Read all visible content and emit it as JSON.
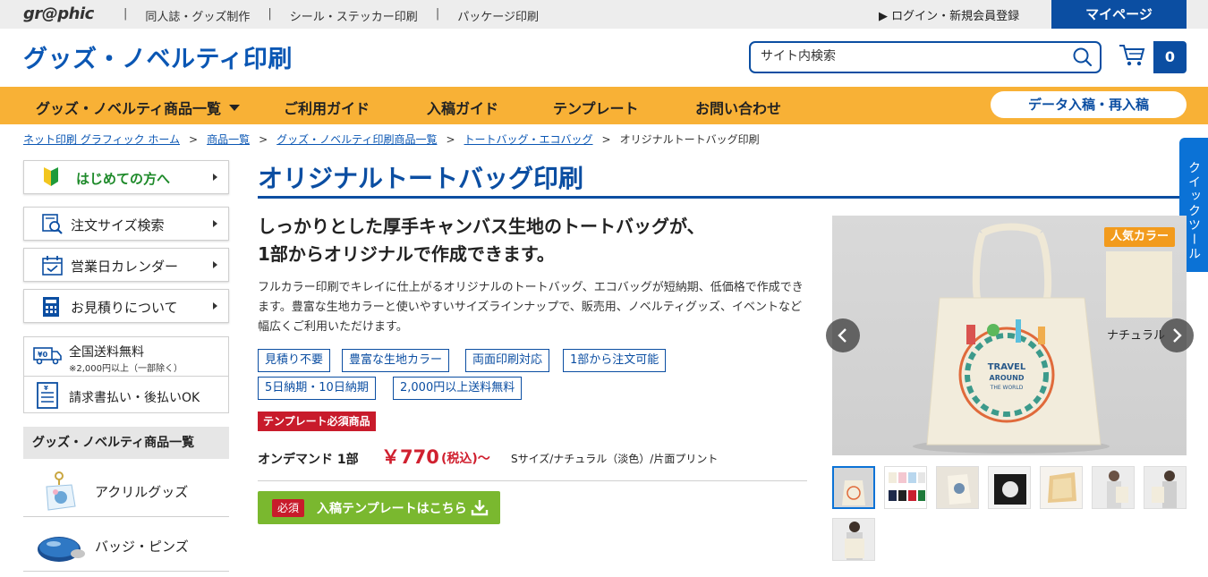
{
  "topbar": {
    "logo": "gr@phic",
    "links": [
      "同人誌・グッズ制作",
      "シール・ステッカー印刷",
      "パッケージ印刷"
    ],
    "login": "▶ ログイン・新規会員登録",
    "mypage": "マイページ"
  },
  "header": {
    "title": "グッズ・ノベルティ印刷",
    "search_placeholder": "サイト内検索",
    "cart_count": "0"
  },
  "gnav": {
    "items": [
      "グッズ・ノベルティ商品一覧",
      "ご利用ガイド",
      "入稿ガイド",
      "テンプレート",
      "お問い合わせ"
    ],
    "upload_button": "データ入稿・再入稿"
  },
  "breadcrumb": {
    "links": [
      "ネット印刷 グラフィック ホーム",
      "商品一覧",
      "グッズ・ノベルティ印刷商品一覧",
      "トートバッグ・エコバッグ"
    ],
    "separator": ">",
    "current": "オリジナルトートバッグ印刷"
  },
  "quick_tool": "クイックツール",
  "sidebar": {
    "buttons": [
      "はじめての方へ",
      "注文サイズ検索",
      "営業日カレンダー",
      "お見積りについて"
    ],
    "info": {
      "shipping_title": "全国送料無料",
      "shipping_note": "※2,000円以上（一部除く）",
      "invoice": "請求書払い・後払いOK"
    },
    "category_heading": "グッズ・ノベルティ商品一覧",
    "categories": [
      "アクリルグッズ",
      "バッジ・ピンズ"
    ]
  },
  "main": {
    "title": "オリジナルトートバッグ印刷",
    "lead_line1": "しっかりとした厚手キャンバス生地のトートバッグが、",
    "lead_line2": "1部からオリジナルで作成できます。",
    "description": "フルカラー印刷でキレイに仕上がるオリジナルのトートバッグ、エコバッグが短納期、低価格で作成できます。豊富な生地カラーと使いやすいサイズラインナップで、販売用、ノベルティグッズ、イベントなど幅広くご利用いただけます。",
    "tags": [
      "見積り不要",
      "豊富な生地カラー",
      "両面印刷対応",
      "1部から注文可能",
      "5日納期・10日納期",
      "2,000円以上送料無料"
    ],
    "template_required": "テンプレート必須商品",
    "price": {
      "label": "オンデマンド 1部",
      "amount": "￥770",
      "tax": "(税込)～",
      "spec": "Sサイズ/ナチュラル（淡色）/片面プリント"
    },
    "template_button": {
      "badge": "必須",
      "label": "入稿テンプレートはこちら"
    }
  },
  "gallery": {
    "popular_label": "人気カラー",
    "swatch_label": "ナチュラル",
    "swatch_color": "#f1ead6",
    "bag_print_line1": "TRAVEL",
    "bag_print_line2": "AROUND",
    "bag_print_line3": "THE WORLD",
    "thumb_count": 8
  },
  "colors": {
    "brand_blue": "#0b4ea2",
    "nav_orange": "#f8b136",
    "button_green": "#7ab82f",
    "required_red": "#c81b2b",
    "price_red": "#d0202f"
  }
}
